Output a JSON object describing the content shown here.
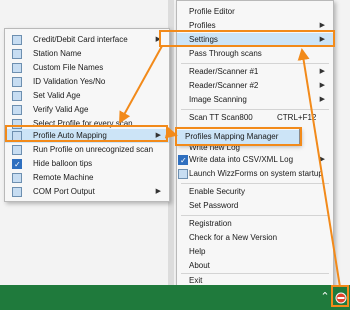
{
  "left_menu": {
    "items": [
      {
        "label": "Credit/Debit Card interface",
        "submenu": true,
        "checked": false
      },
      {
        "label": "Station Name",
        "submenu": false,
        "checked": false
      },
      {
        "label": "Custom File Names",
        "submenu": false,
        "checked": false
      },
      {
        "label": "ID Validation Yes/No",
        "submenu": false,
        "checked": false
      },
      {
        "label": "Set Valid Age",
        "submenu": false,
        "checked": false
      },
      {
        "label": "Verify Valid Age",
        "submenu": false,
        "checked": false
      },
      {
        "label": "Select Profile for every scan",
        "submenu": false,
        "checked": false
      },
      {
        "label": "Profile Auto Mapping",
        "submenu": true,
        "checked": false,
        "highlighted": true
      },
      {
        "label": "Run Profile on unrecognized scan",
        "submenu": false,
        "checked": false
      },
      {
        "label": "Hide balloon tips",
        "submenu": false,
        "checked": true
      },
      {
        "label": "Remote Machine",
        "submenu": false,
        "checked": false
      },
      {
        "label": "COM Port Output",
        "submenu": true,
        "checked": false
      }
    ]
  },
  "right_menu": {
    "items": [
      {
        "label": "Profile Editor",
        "submenu": false
      },
      {
        "label": "Profiles",
        "submenu": true
      },
      {
        "label": "Settings",
        "submenu": true,
        "highlighted": true
      },
      {
        "label": "Pass Through scans",
        "submenu": false
      },
      {
        "label": "Reader/Scanner #1",
        "submenu": true
      },
      {
        "label": "Reader/Scanner #2",
        "submenu": true
      },
      {
        "label": "Image Scanning",
        "submenu": true
      },
      {
        "label": "Scan TT Scan800",
        "shortcut": "CTRL+F12"
      },
      {
        "label": "Write new Log",
        "submenu": false
      },
      {
        "label": "Write data into CSV/XML Log",
        "submenu": true
      },
      {
        "label": "Launch WizzForms on system startup",
        "submenu": false
      },
      {
        "label": "Enable Security",
        "submenu": false
      },
      {
        "label": "Set Password",
        "submenu": false
      },
      {
        "label": "Registration",
        "submenu": false
      },
      {
        "label": "Check for a New Version",
        "submenu": false
      },
      {
        "label": "Help",
        "submenu": false
      },
      {
        "label": "About",
        "submenu": false
      },
      {
        "label": "Exit",
        "submenu": false
      }
    ]
  },
  "submenu": {
    "items": [
      {
        "label": "Profiles Mapping Manager",
        "highlighted": true
      }
    ]
  },
  "taskbar": {
    "chevron_glyph": "^",
    "tray_icon": "app-tray-icon"
  },
  "colors": {
    "accent_highlight": "#f28a1a",
    "taskbar": "#1f7a3c",
    "menu_hover": "#cce4f7"
  }
}
